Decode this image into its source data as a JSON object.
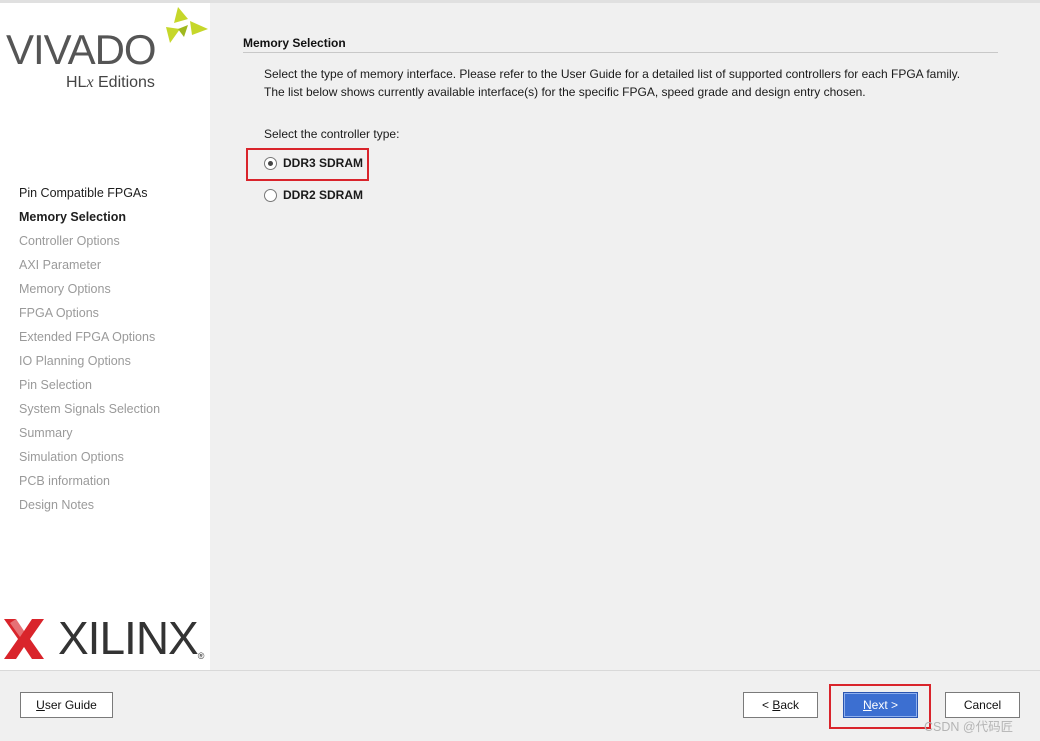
{
  "logo": {
    "product": "VIVADO",
    "edition_prefix": "HL",
    "edition_x": "x",
    "edition_suffix": " Editions",
    "vendor": "XILINX",
    "registered": "®"
  },
  "nav": {
    "items": [
      {
        "label": "Pin Compatible FPGAs",
        "state": "done"
      },
      {
        "label": "Memory Selection",
        "state": "current"
      },
      {
        "label": "Controller Options",
        "state": "pending"
      },
      {
        "label": "AXI Parameter",
        "state": "pending"
      },
      {
        "label": "Memory Options",
        "state": "pending"
      },
      {
        "label": "FPGA Options",
        "state": "pending"
      },
      {
        "label": "Extended FPGA Options",
        "state": "pending"
      },
      {
        "label": "IO Planning Options",
        "state": "pending"
      },
      {
        "label": "Pin Selection",
        "state": "pending"
      },
      {
        "label": "System Signals Selection",
        "state": "pending"
      },
      {
        "label": "Summary",
        "state": "pending"
      },
      {
        "label": "Simulation Options",
        "state": "pending"
      },
      {
        "label": "PCB information",
        "state": "pending"
      },
      {
        "label": "Design Notes",
        "state": "pending"
      }
    ]
  },
  "main": {
    "title": "Memory Selection",
    "description_line1": "Select the type of memory interface. Please refer to the User Guide for a detailed list of supported controllers for each FPGA family.",
    "description_line2": "The list below shows currently available interface(s) for the specific FPGA, speed grade and design entry chosen.",
    "controller_label": "Select the controller type:",
    "options": [
      {
        "label": "DDR3 SDRAM",
        "selected": true
      },
      {
        "label": "DDR2 SDRAM",
        "selected": false
      }
    ]
  },
  "buttons": {
    "user_guide": {
      "mnemonic": "U",
      "rest": "ser Guide"
    },
    "back": {
      "prefix": "< ",
      "mnemonic": "B",
      "rest": "ack"
    },
    "next": {
      "mnemonic": "N",
      "rest": "ext >"
    },
    "cancel": "Cancel"
  },
  "watermark": "CSDN @代码匠",
  "colors": {
    "highlight": "#d9242b",
    "primary_button": "#3c6fd1",
    "logo_green": "#c6d72a",
    "logo_red": "#d9242b"
  }
}
